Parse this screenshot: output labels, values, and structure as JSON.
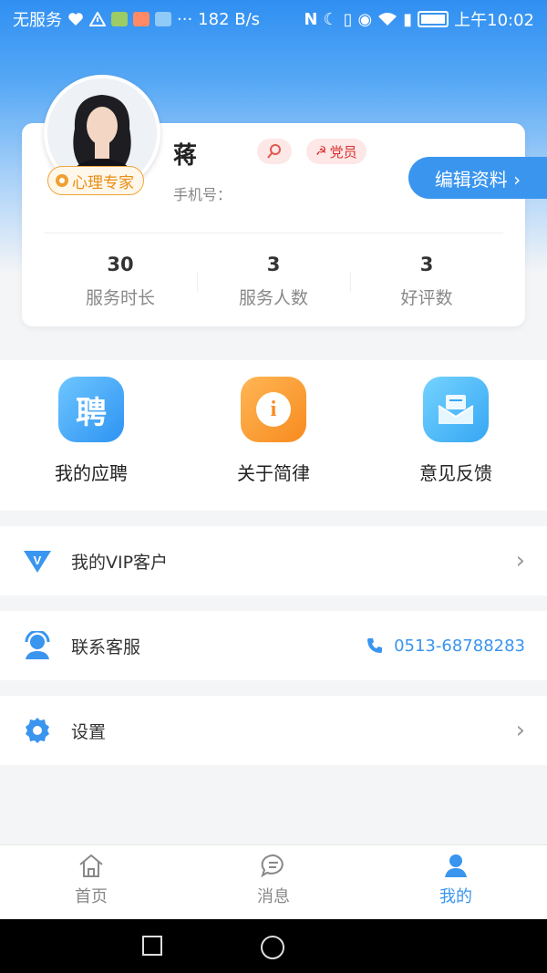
{
  "status_bar": {
    "carrier": "无服务",
    "speed": "182 B/s",
    "time": "上午10:02"
  },
  "profile": {
    "name": "蒋",
    "badge": "心理专家",
    "party_tag": "党员",
    "phone_label": "手机号：",
    "edit_button": "编辑资料 ›"
  },
  "stats": [
    {
      "value": "30",
      "label": "服务时长"
    },
    {
      "value": "3",
      "label": "服务人数"
    },
    {
      "value": "3",
      "label": "好评数"
    }
  ],
  "actions": [
    {
      "label": "我的应聘",
      "icon": "recruit-icon",
      "glyph": "聘"
    },
    {
      "label": "关于简律",
      "icon": "info-icon",
      "glyph": "i"
    },
    {
      "label": "意见反馈",
      "icon": "feedback-mail-icon"
    }
  ],
  "menu": {
    "vip": "我的VIP客户",
    "service": "联系客服",
    "service_phone": "0513-68788283",
    "settings": "设置"
  },
  "bottom_nav": [
    {
      "label": "首页",
      "icon": "home-icon"
    },
    {
      "label": "消息",
      "icon": "message-icon"
    },
    {
      "label": "我的",
      "icon": "profile-icon",
      "active": true
    }
  ],
  "colors": {
    "primary": "#3a95ef",
    "orange": "#f1a43a",
    "party_red": "#d8302e"
  }
}
